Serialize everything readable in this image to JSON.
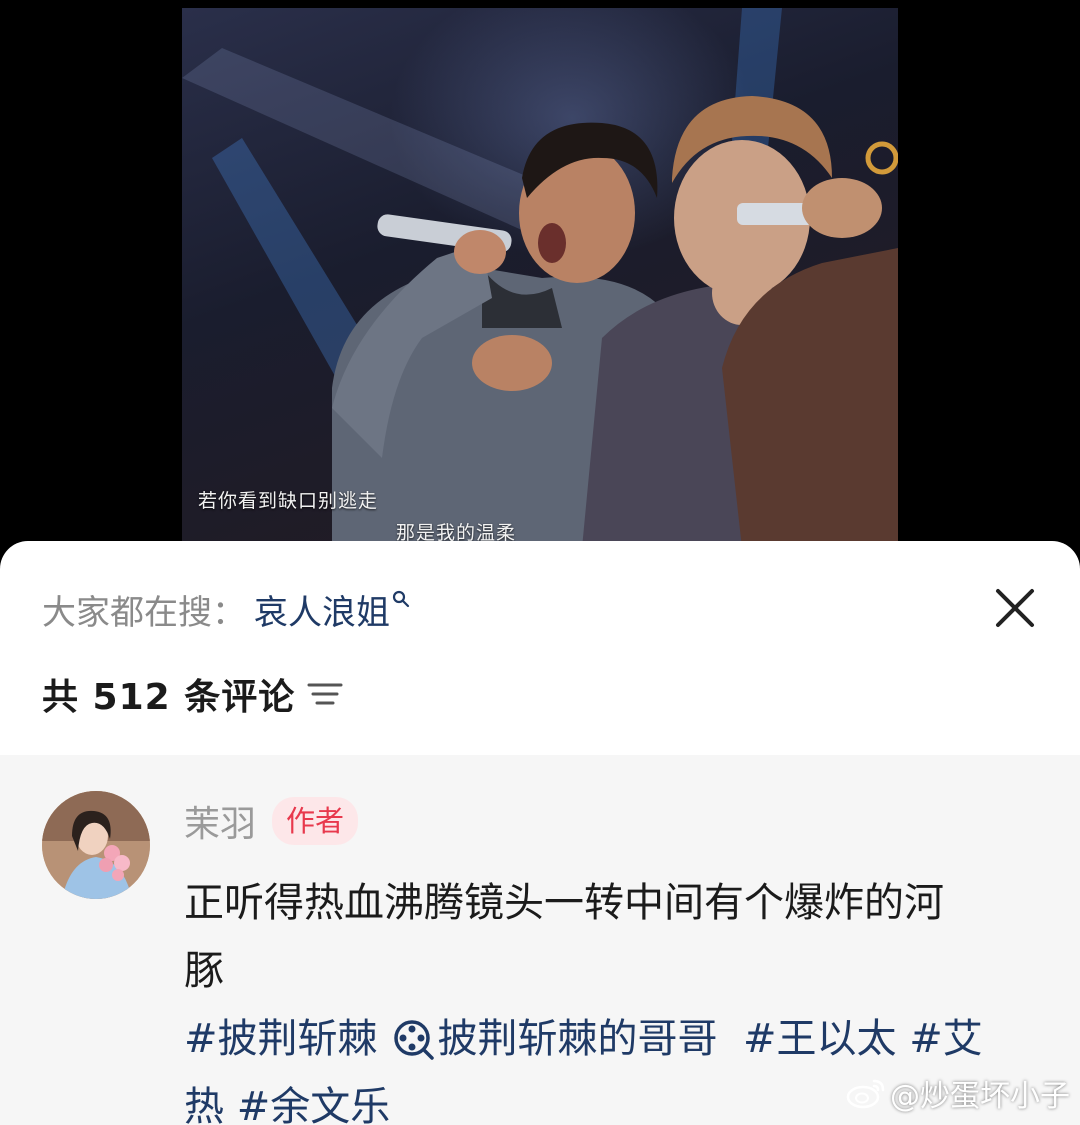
{
  "video": {
    "subtitle_line1": "若你看到缺口别逃走",
    "subtitle_line2": "那是我的温柔"
  },
  "sheet": {
    "search_prefix": "大家都在搜：",
    "search_term": "哀人浪姐",
    "comment_count_text": "共 512 条评论"
  },
  "comment": {
    "author_name": "茉羽",
    "author_badge": "作者",
    "text_line1": "正听得热血沸腾镜头一转中间有个爆炸的河",
    "text_line2": "豚",
    "tags": {
      "tag1": "#披荆斩棘",
      "topic": "披荆斩棘的哥哥",
      "tag2": "#王以太",
      "tag3_part1": "#艾",
      "tag3_part2": "热",
      "tag4": "#余文乐"
    }
  },
  "watermark": {
    "text": "@炒蛋坏小子",
    "icon": "weibo-icon"
  },
  "colors": {
    "link": "#1f3a66",
    "badge_text": "#e8394d",
    "badge_bg": "#fde7e9",
    "muted": "#9a9a9a",
    "comment_bg": "#f6f6f6"
  }
}
